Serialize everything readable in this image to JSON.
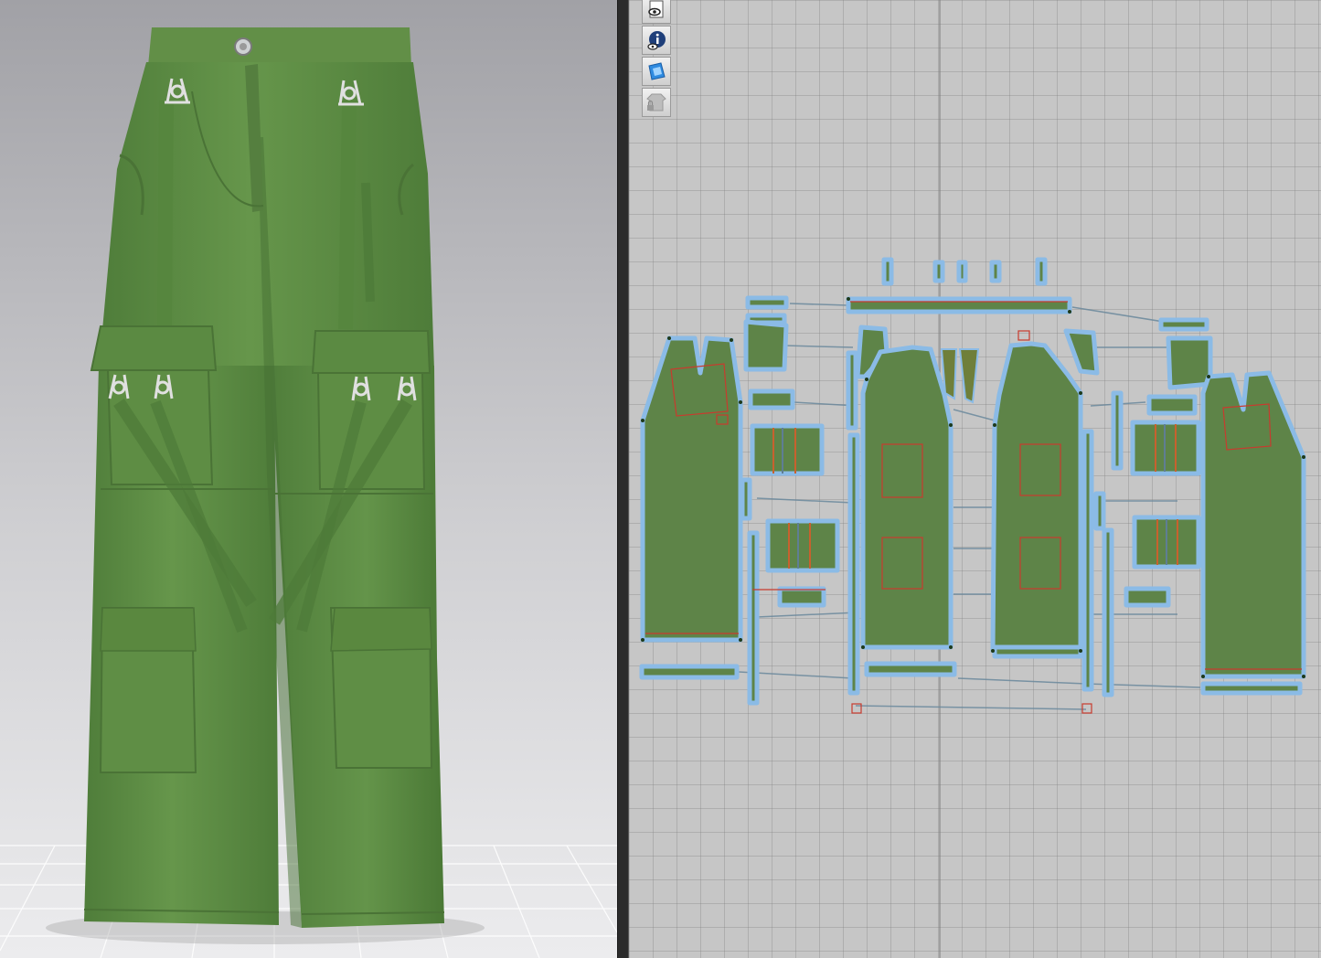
{
  "viewport3d": {
    "icon": "cargo-pants-avatar",
    "colors": {
      "fabric": "#5f8f45",
      "fabric_shadow": "#4b7736",
      "hardware": "#d8d8d8",
      "background_top": "#a3a3a8",
      "background_bottom": "#e6e6e8"
    }
  },
  "window2d": {
    "colors": {
      "canvas": "#c6c6c6",
      "grid": "#8f8f8f",
      "piece_fill": "#5e8448",
      "piece_outline": "#8bbbe6",
      "internal_line": "#c83b2e",
      "sewing_line": "#5f7e94"
    },
    "toolbar": [
      {
        "icon": "show-pattern-icon"
      },
      {
        "icon": "info-icon"
      },
      {
        "icon": "texture-icon"
      },
      {
        "icon": "avatar-lock-icon"
      }
    ]
  }
}
